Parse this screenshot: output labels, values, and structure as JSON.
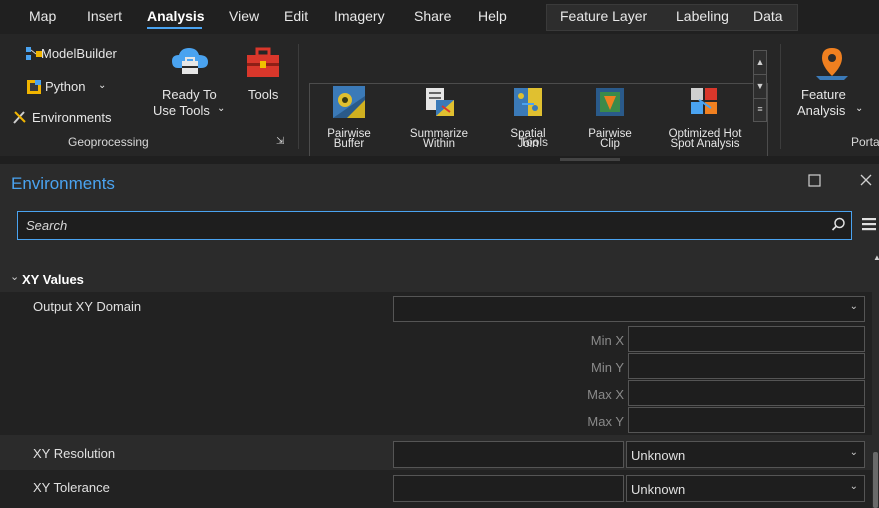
{
  "menu": {
    "tabs": [
      "Map",
      "Insert",
      "Analysis",
      "View",
      "Edit",
      "Imagery",
      "Share",
      "Help"
    ],
    "active_tab": "Analysis",
    "context_tabs": [
      "Feature Layer",
      "Labeling",
      "Data"
    ]
  },
  "ribbon": {
    "geoprocessing": {
      "model_builder": "ModelBuilder",
      "python": "Python",
      "environments": "Environments",
      "ready_to_use_line1": "Ready To",
      "ready_to_use_line2": "Use Tools",
      "tools": "Tools",
      "group_label": "Geoprocessing"
    },
    "tools_gallery": {
      "items": [
        {
          "line1": "Pairwise",
          "line2": "Buffer"
        },
        {
          "line1": "Summarize",
          "line2": "Within"
        },
        {
          "line1": "Spatial",
          "line2": "Join"
        },
        {
          "line1": "Pairwise",
          "line2": "Clip"
        },
        {
          "line1": "Optimized Hot",
          "line2": "Spot Analysis"
        }
      ],
      "group_label": "Tools"
    },
    "portal": {
      "feature_analysis_line1": "Feature",
      "feature_analysis_line2": "Analysis",
      "group_label": "Porta"
    }
  },
  "pane": {
    "title": "Environments",
    "search_placeholder": "Search",
    "section": "XY Values",
    "output_xy_domain": "Output XY Domain",
    "min_x": "Min X",
    "min_y": "Min Y",
    "max_x": "Max X",
    "max_y": "Max Y",
    "xy_resolution": "XY Resolution",
    "xy_resolution_unit": "Unknown",
    "xy_tolerance": "XY Tolerance",
    "xy_tolerance_unit": "Unknown"
  },
  "colors": {
    "accent": "#4aa3f0",
    "background": "#2b2b2b",
    "menubar": "#202020"
  }
}
